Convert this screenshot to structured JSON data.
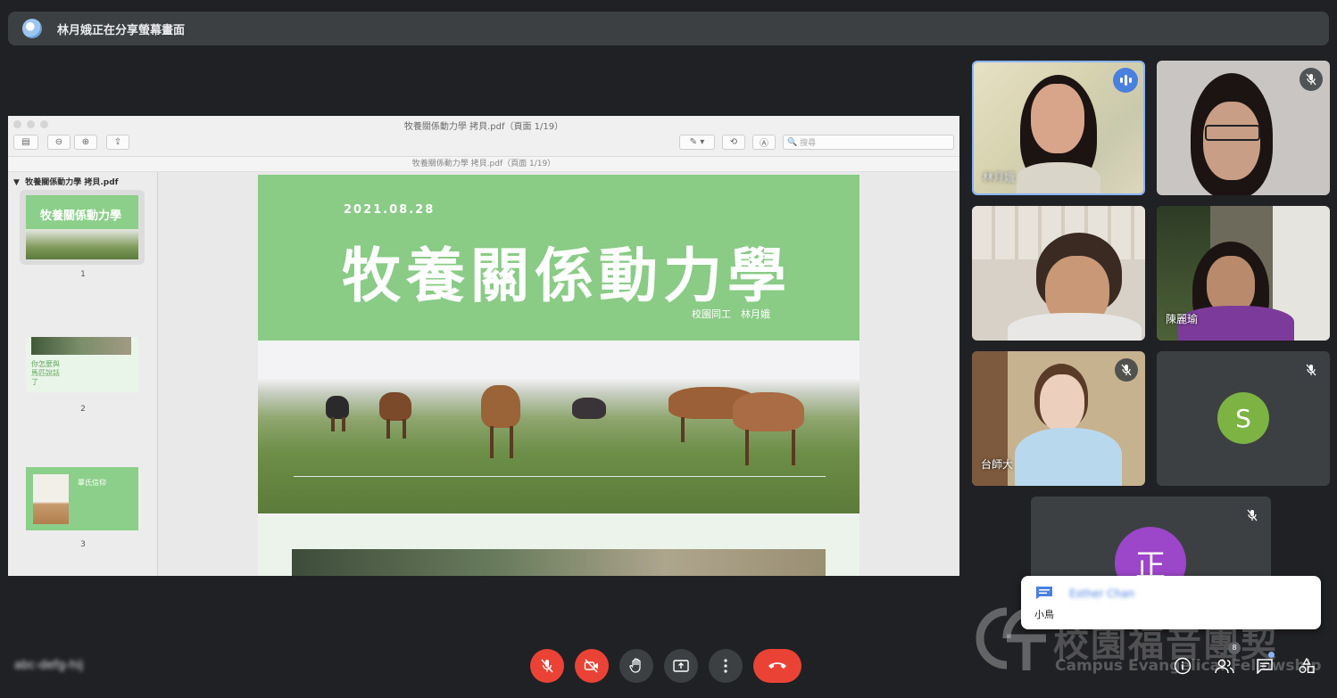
{
  "banner": {
    "text": "林月娥正在分享螢幕畫面"
  },
  "shared_screen": {
    "window_title": "牧養關係動力學 拷貝.pdf（頁面 1/19）",
    "subtitle": "牧養關係動力學 拷貝.pdf（頁面 1/19）",
    "search_placeholder": "搜尋",
    "sidebar_file": "牧養關係動力學 拷貝.pdf",
    "thumbnails": [
      {
        "num": "1",
        "title": "牧養關係動力學"
      },
      {
        "num": "2",
        "title": "你怎麼與馬匹說話了"
      },
      {
        "num": "3",
        "title": "畢氏信仰"
      }
    ],
    "slide": {
      "date": "2021.08.28",
      "title": "牧養關係動力學",
      "author": "校園同工　林月娥"
    }
  },
  "participants": [
    {
      "name": "林月娥",
      "state": "speaking"
    },
    {
      "name": "",
      "state": "muted"
    },
    {
      "name": "",
      "state": "video"
    },
    {
      "name": "陳麗瑜",
      "state": "video"
    },
    {
      "name": "台師大",
      "state": "muted"
    },
    {
      "name": "",
      "initial": "S",
      "state": "muted",
      "color": "#7cb342"
    },
    {
      "name": "",
      "initial": "正",
      "state": "muted",
      "color": "#9c46c9"
    }
  ],
  "chat": {
    "sender": "Esther Chan",
    "message": "小鳥"
  },
  "watermark": {
    "cn": "校園福音團契",
    "en": "Campus Evangelical Fellowship"
  },
  "meeting_info": "abc-defg-hij",
  "controls": {
    "mic": "mic-off-icon",
    "camera": "camera-off-icon",
    "hand": "raise-hand-icon",
    "present": "present-screen-icon",
    "more": "more-options-icon",
    "end": "end-call-icon"
  },
  "participant_count": "8",
  "colors": {
    "accent": "#8ab4f8",
    "danger": "#ea4335",
    "surface": "#3c4043",
    "bg": "#202124",
    "slide_green": "#8acb86"
  }
}
